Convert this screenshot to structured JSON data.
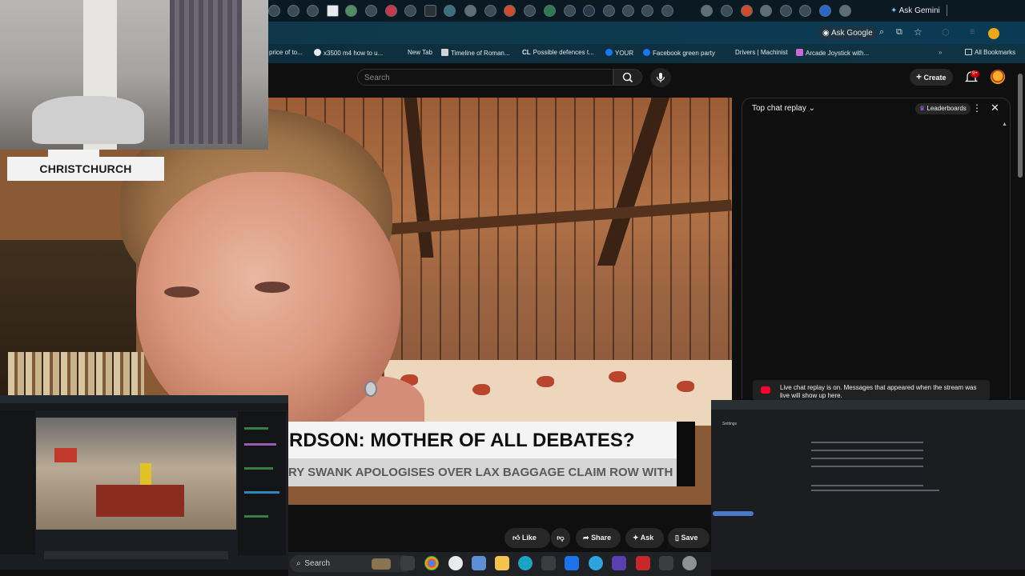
{
  "browser": {
    "gemini_label": "Ask Gemini",
    "ask_google_label": "Ask Google",
    "bookmarks": [
      "price of to...",
      "x3500 m4 how to u...",
      "New Tab",
      "Timeline of Roman...",
      "Possible defences t...",
      "YOUR",
      "Facebook green party",
      "Drivers | Machinist",
      "Arcade Joystick with..."
    ],
    "all_bookmarks_label": "All Bookmarks"
  },
  "youtube": {
    "search_placeholder": "Search",
    "create_label": "Create",
    "notification_count": "9+",
    "actions": {
      "like": "Like",
      "share": "Share",
      "ask": "Ask",
      "save": "Save"
    }
  },
  "video": {
    "location_badge": "CHRISTCHURCH",
    "headline": "RDSON: MOTHER OF ALL DEBATES?",
    "ticker": "RY SWANK APOLOGISES OVER LAX BAGGAGE CLAIM ROW WITH MAK"
  },
  "chat": {
    "title": "Top chat replay",
    "leaderboards_label": "Leaderboards",
    "replay_notice": "Live chat replay is on. Messages that appeared when the stream was live will show up here."
  },
  "screen_right": {
    "settings_label": "Settings"
  },
  "taskbar": {
    "search_label": "Search"
  },
  "colors": {
    "youtube_red": "#ff0033",
    "chrome_bg": "#0b1a22",
    "page_bg": "#0f0f0f"
  }
}
